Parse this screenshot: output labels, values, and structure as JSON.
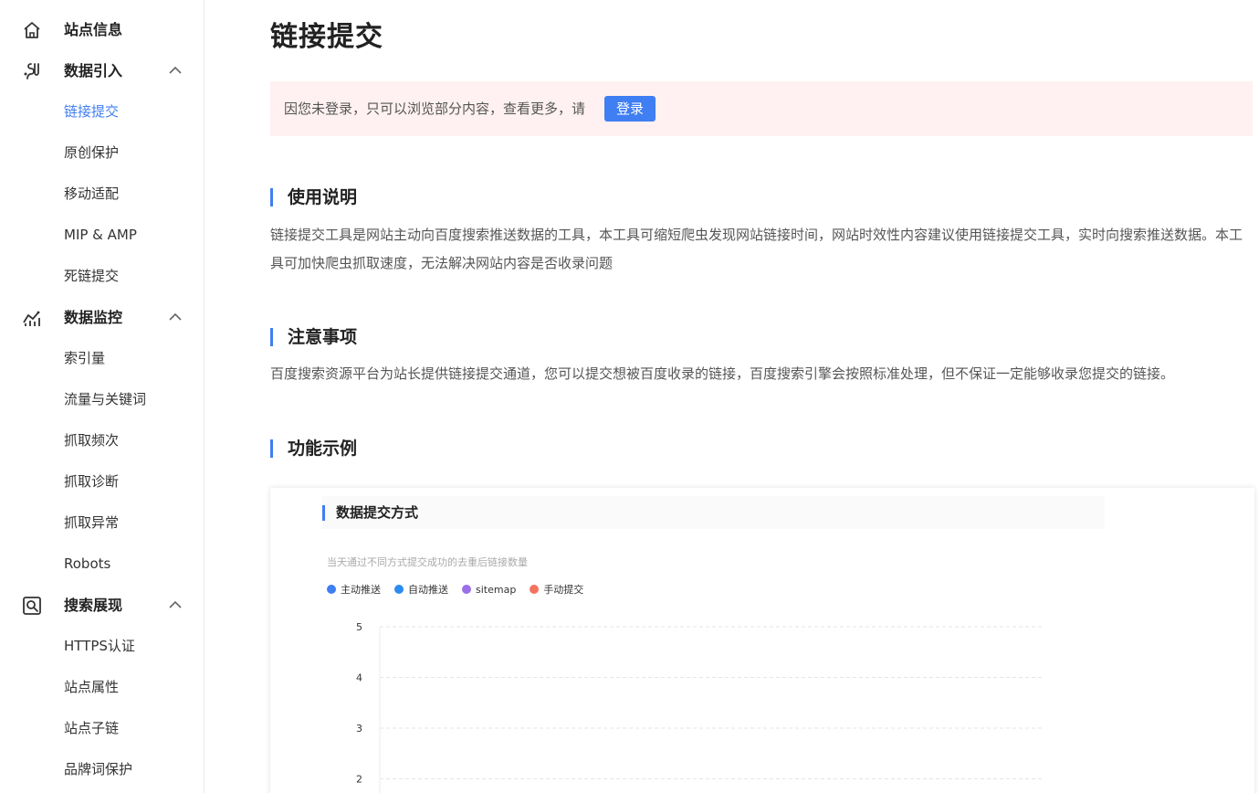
{
  "sidebar": {
    "groups": [
      {
        "label": "站点信息",
        "icon": "home-icon",
        "items": []
      },
      {
        "label": "数据引入",
        "icon": "data-import-icon",
        "expanded": true,
        "items": [
          "链接提交",
          "原创保护",
          "移动适配",
          "MIP & AMP",
          "死链提交"
        ]
      },
      {
        "label": "数据监控",
        "icon": "data-monitor-icon",
        "expanded": true,
        "items": [
          "索引量",
          "流量与关键词",
          "抓取频次",
          "抓取诊断",
          "抓取异常",
          "Robots"
        ]
      },
      {
        "label": "搜索展现",
        "icon": "search-display-icon",
        "expanded": true,
        "items": [
          "HTTPS认证",
          "站点属性",
          "站点子链",
          "品牌词保护"
        ]
      }
    ],
    "active_item": "链接提交"
  },
  "main": {
    "title": "链接提交",
    "notice": {
      "text": "因您未登录，只可以浏览部分内容，查看更多，请",
      "button": "登录"
    },
    "sections": [
      {
        "title": "使用说明",
        "text": "链接提交工具是网站主动向百度搜索推送数据的工具，本工具可缩短爬虫发现网站链接时间，网站时效性内容建议使用链接提交工具，实时向搜索推送数据。本工具可加快爬虫抓取速度，无法解决网站内容是否收录问题"
      },
      {
        "title": "注意事项",
        "text": "百度搜索资源平台为站长提供链接提交通道，您可以提交想被百度收录的链接，百度搜索引擎会按照标准处理，但不保证一定能够收录您提交的链接。"
      },
      {
        "title": "功能示例",
        "text": ""
      }
    ],
    "example": {
      "title": "数据提交方式",
      "subtitle": "当天通过不同方式提交成功的去重后链接数量"
    }
  },
  "colors": {
    "accent": "#3f7ef3",
    "notice_bg": "#fff1f1"
  },
  "chart_data": {
    "type": "line",
    "series": [
      {
        "name": "主动推送",
        "color": "#3f7ef3",
        "values": []
      },
      {
        "name": "自动推送",
        "color": "#2b8cf0",
        "values": []
      },
      {
        "name": "sitemap",
        "color": "#9b6fe6",
        "values": []
      },
      {
        "name": "手动提交",
        "color": "#f2735f",
        "values": []
      }
    ],
    "y_ticks": [
      5,
      4,
      3,
      2
    ],
    "ylim": [
      0,
      5
    ],
    "grid": true,
    "legend": "top-left"
  }
}
